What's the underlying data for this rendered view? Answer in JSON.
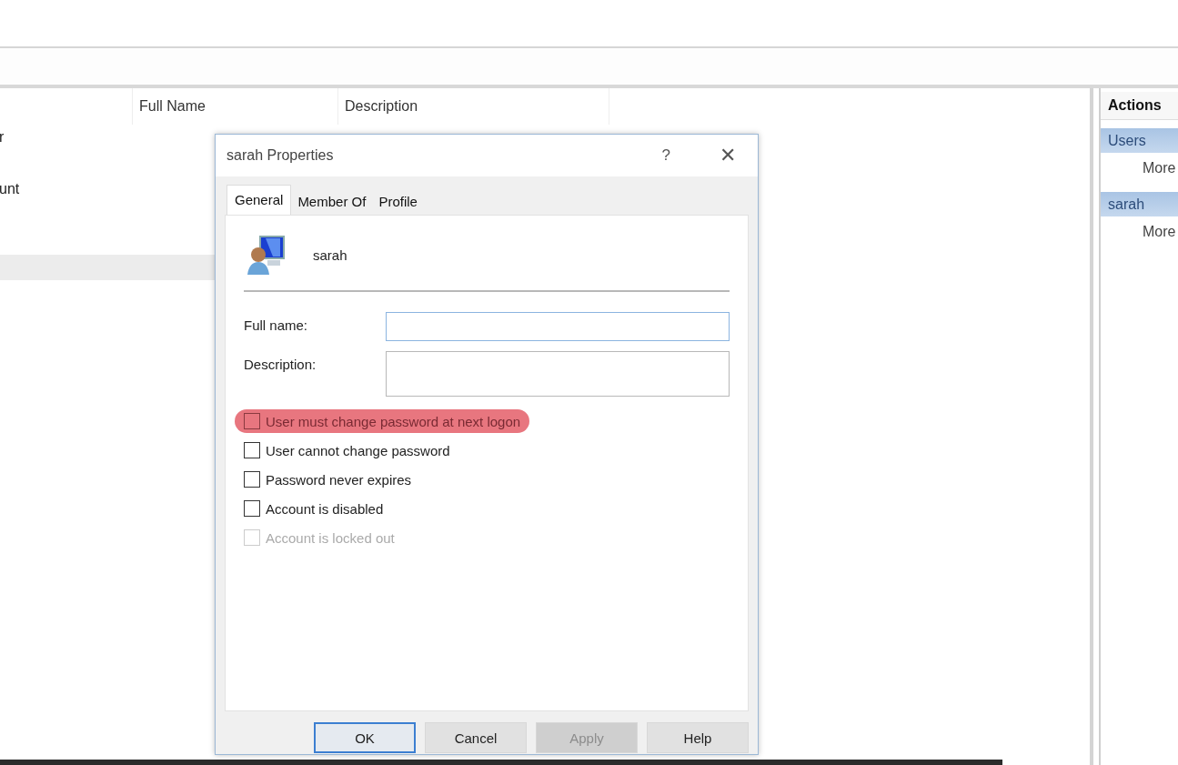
{
  "list": {
    "columns": [
      {
        "label": "Full Name"
      },
      {
        "label": "Description"
      }
    ],
    "rows": [
      {
        "name": "r",
        "selected": false
      },
      {
        "selected": false
      },
      {
        "name": "unt",
        "selected": false
      },
      {
        "selected": false
      },
      {
        "selected": false
      },
      {
        "selected": true
      }
    ]
  },
  "actions": {
    "title": "Actions",
    "groups": [
      {
        "label": "Users",
        "items": [
          "More"
        ]
      },
      {
        "label": "sarah",
        "items": [
          "More"
        ]
      }
    ]
  },
  "dialog": {
    "title": "sarah Properties",
    "help": "?",
    "close": "✕",
    "tabs": [
      {
        "label": "General",
        "selected": true
      },
      {
        "label": "Member Of",
        "selected": false
      },
      {
        "label": "Profile",
        "selected": false
      }
    ],
    "user": "sarah",
    "fields": [
      {
        "label": "Full name:",
        "kind": "line",
        "focused": true
      },
      {
        "label": "Description:",
        "kind": "box",
        "focused": false
      }
    ],
    "options": [
      {
        "label": "User must change password at next logon",
        "checked": false,
        "disabled": false,
        "highlighted": true
      },
      {
        "label": "User cannot change password",
        "checked": false,
        "disabled": false,
        "highlighted": false
      },
      {
        "label": "Password never expires",
        "checked": false,
        "disabled": false,
        "highlighted": false
      },
      {
        "label": "Account is disabled",
        "checked": false,
        "disabled": false,
        "highlighted": false
      },
      {
        "label": "Account is locked out",
        "checked": false,
        "disabled": true,
        "highlighted": false
      }
    ],
    "buttons": [
      {
        "label": "OK",
        "default": true,
        "disabled": false
      },
      {
        "label": "Cancel",
        "default": false,
        "disabled": false
      },
      {
        "label": "Apply",
        "default": false,
        "disabled": true
      },
      {
        "label": "Help",
        "default": false,
        "disabled": false
      }
    ]
  }
}
